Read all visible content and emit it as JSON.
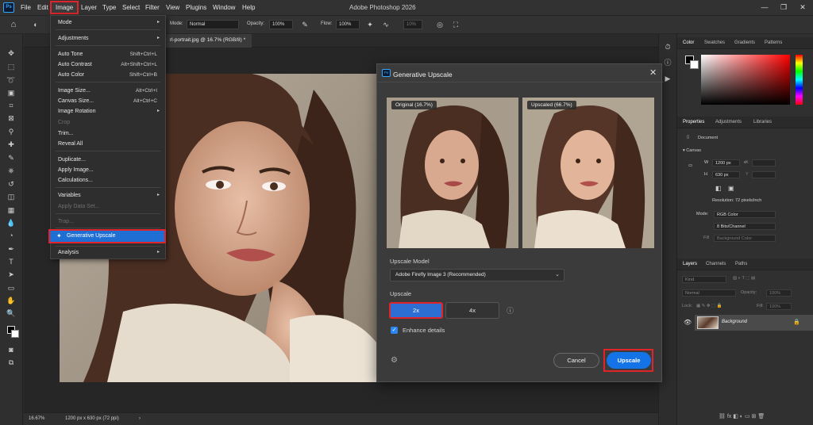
{
  "app": {
    "title": "Adobe Photoshop 2026",
    "logo": "Ps"
  },
  "menubar": {
    "items": [
      "File",
      "Edit",
      "Image",
      "Layer",
      "Type",
      "Select",
      "Filter",
      "View",
      "Plugins",
      "Window",
      "Help"
    ]
  },
  "window_controls": {
    "minimize": "—",
    "restore": "❐",
    "close": "✕"
  },
  "options_bar": {
    "mode_label": "Mode:",
    "mode_value": "Normal",
    "opacity_label": "Opacity:",
    "opacity_value": "100%",
    "flow_label": "Flow:",
    "flow_value": "100%",
    "smoothing_value": "10%"
  },
  "document_tab": {
    "title": "rl-portrait.jpg @ 16.7% (RGB/8) *"
  },
  "status_bar": {
    "zoom": "16.67%",
    "info": "1200 px x 630 px (72 ppi)"
  },
  "image_menu": {
    "items": [
      {
        "label": "Mode",
        "submenu": true
      },
      {
        "label": "Adjustments",
        "submenu": true
      },
      {
        "label": "Auto Tone",
        "shortcut": "Shift+Ctrl+L"
      },
      {
        "label": "Auto Contrast",
        "shortcut": "Alt+Shift+Ctrl+L"
      },
      {
        "label": "Auto Color",
        "shortcut": "Shift+Ctrl+B"
      },
      {
        "label": "Image Size...",
        "shortcut": "Alt+Ctrl+I"
      },
      {
        "label": "Canvas Size...",
        "shortcut": "Alt+Ctrl+C"
      },
      {
        "label": "Image Rotation",
        "submenu": true
      },
      {
        "label": "Crop",
        "disabled": true
      },
      {
        "label": "Trim..."
      },
      {
        "label": "Reveal All"
      },
      {
        "label": "Duplicate..."
      },
      {
        "label": "Apply Image..."
      },
      {
        "label": "Calculations..."
      },
      {
        "label": "Variables",
        "submenu": true
      },
      {
        "label": "Apply Data Set...",
        "disabled": true
      },
      {
        "label": "Trap...",
        "disabled": true
      },
      {
        "label": "Generative Upscale",
        "highlighted": true
      },
      {
        "label": "Analysis",
        "submenu": true
      }
    ]
  },
  "dialog": {
    "title": "Generative Upscale",
    "original_label": "Original (16.7%)",
    "upscaled_label": "Upscaled (66.7%)",
    "model_label": "Upscale Model",
    "model_value": "Adobe Firefly Image 3 (Recommended)",
    "upscale_label": "Upscale",
    "options": [
      "2x",
      "4x"
    ],
    "selected_option": "2x",
    "enhance_label": "Enhance details",
    "enhance_checked": true,
    "cancel_label": "Cancel",
    "upscale_button_label": "Upscale"
  },
  "color_panel": {
    "tabs": [
      "Color",
      "Swatches",
      "Gradients",
      "Patterns"
    ],
    "active": "Color"
  },
  "properties_panel": {
    "tabs": [
      "Properties",
      "Adjustments",
      "Libraries"
    ],
    "active": "Properties",
    "doc_label": "Document",
    "canvas_label": "Canvas",
    "w_label": "W",
    "w_value": "1200 px",
    "h_label": "H",
    "h_value": "630 px",
    "x_label": "X",
    "y_label": "Y",
    "resolution": "Resolution: 72 pixels/inch",
    "mode_label": "Mode:",
    "mode_value": "RGB Color",
    "bits_value": "8 Bits/Channel",
    "fill_label": "Fill",
    "fill_value": "Background Color"
  },
  "layers_panel": {
    "tabs": [
      "Layers",
      "Channels",
      "Paths"
    ],
    "active": "Layers",
    "kind_placeholder": "Kind",
    "blend_mode": "Normal",
    "opacity_label": "Opacity:",
    "opacity_value": "100%",
    "lock_label": "Lock:",
    "fill_label": "Fill:",
    "fill_value": "100%",
    "layer_name": "Background"
  },
  "colors": {
    "accent": "#1473e6",
    "highlight_border": "#e0242c",
    "menu_highlight": "#1f6ed4"
  }
}
